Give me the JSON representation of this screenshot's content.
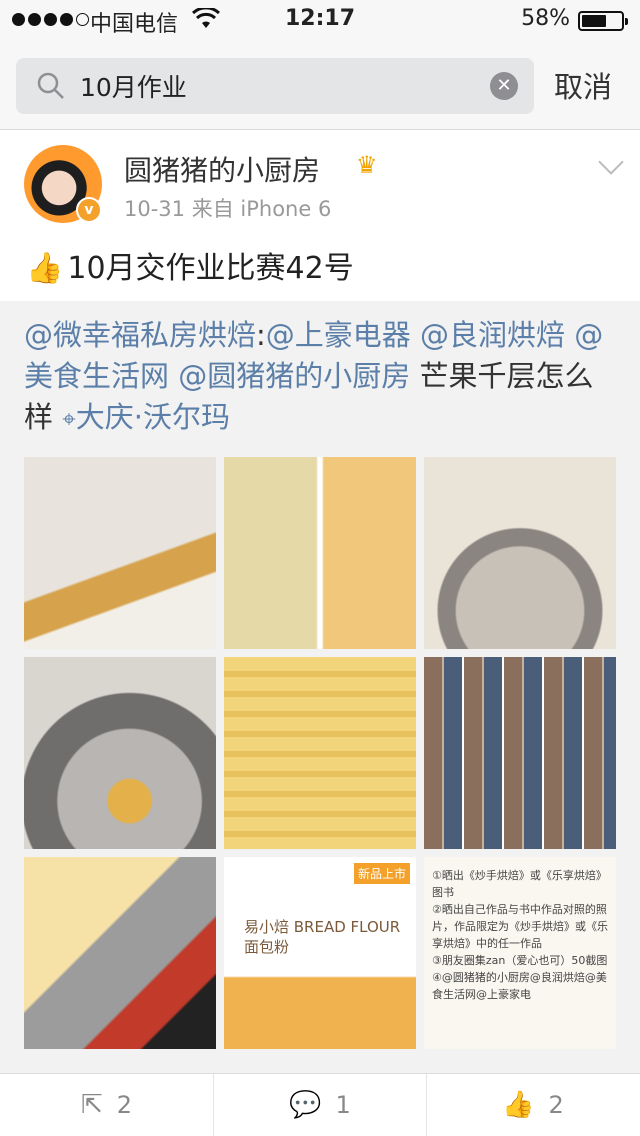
{
  "status_bar": {
    "carrier": "中国电信",
    "time": "12:17",
    "battery": "58%",
    "battery_level": 0.58,
    "signal_bars_filled": 4,
    "signal_bars_total": 5
  },
  "search": {
    "query": "10月作业",
    "cancel_label": "取消"
  },
  "post": {
    "username": "圆猪猪的小厨房",
    "date": "10-31",
    "source": "来自 iPhone 6",
    "text": "10月交作业比赛42号"
  },
  "repost": {
    "mention_1": "@微幸福私房烘焙",
    "colon": ":",
    "mention_2": "@上豪电器",
    "mention_3": "@良润烘焙",
    "mention_4": "@美食生活网",
    "mention_5": "@圆猪猪的小厨房",
    "plain_text": "芒果千层怎么样",
    "location": "大庆·沃尔玛"
  },
  "images": {
    "bread_flour_label": "易小焙 BREAD FLOUR 面包粉",
    "new_badge": "新品上市",
    "rules": [
      "①晒出《炒手烘焙》或《乐享烘焙》图书",
      "②晒出自己作品与书中作品对照的照片，作品限定为《炒手烘焙》或《乐享烘焙》中的任一作品",
      "③朋友圈集zan（爱心也可）50截图",
      "④@圆猪猪的小厨房@良润烘焙@美食生活网@上豪家电"
    ]
  },
  "actions": {
    "repost_count": "2",
    "comment_count": "1",
    "like_count": "2"
  }
}
